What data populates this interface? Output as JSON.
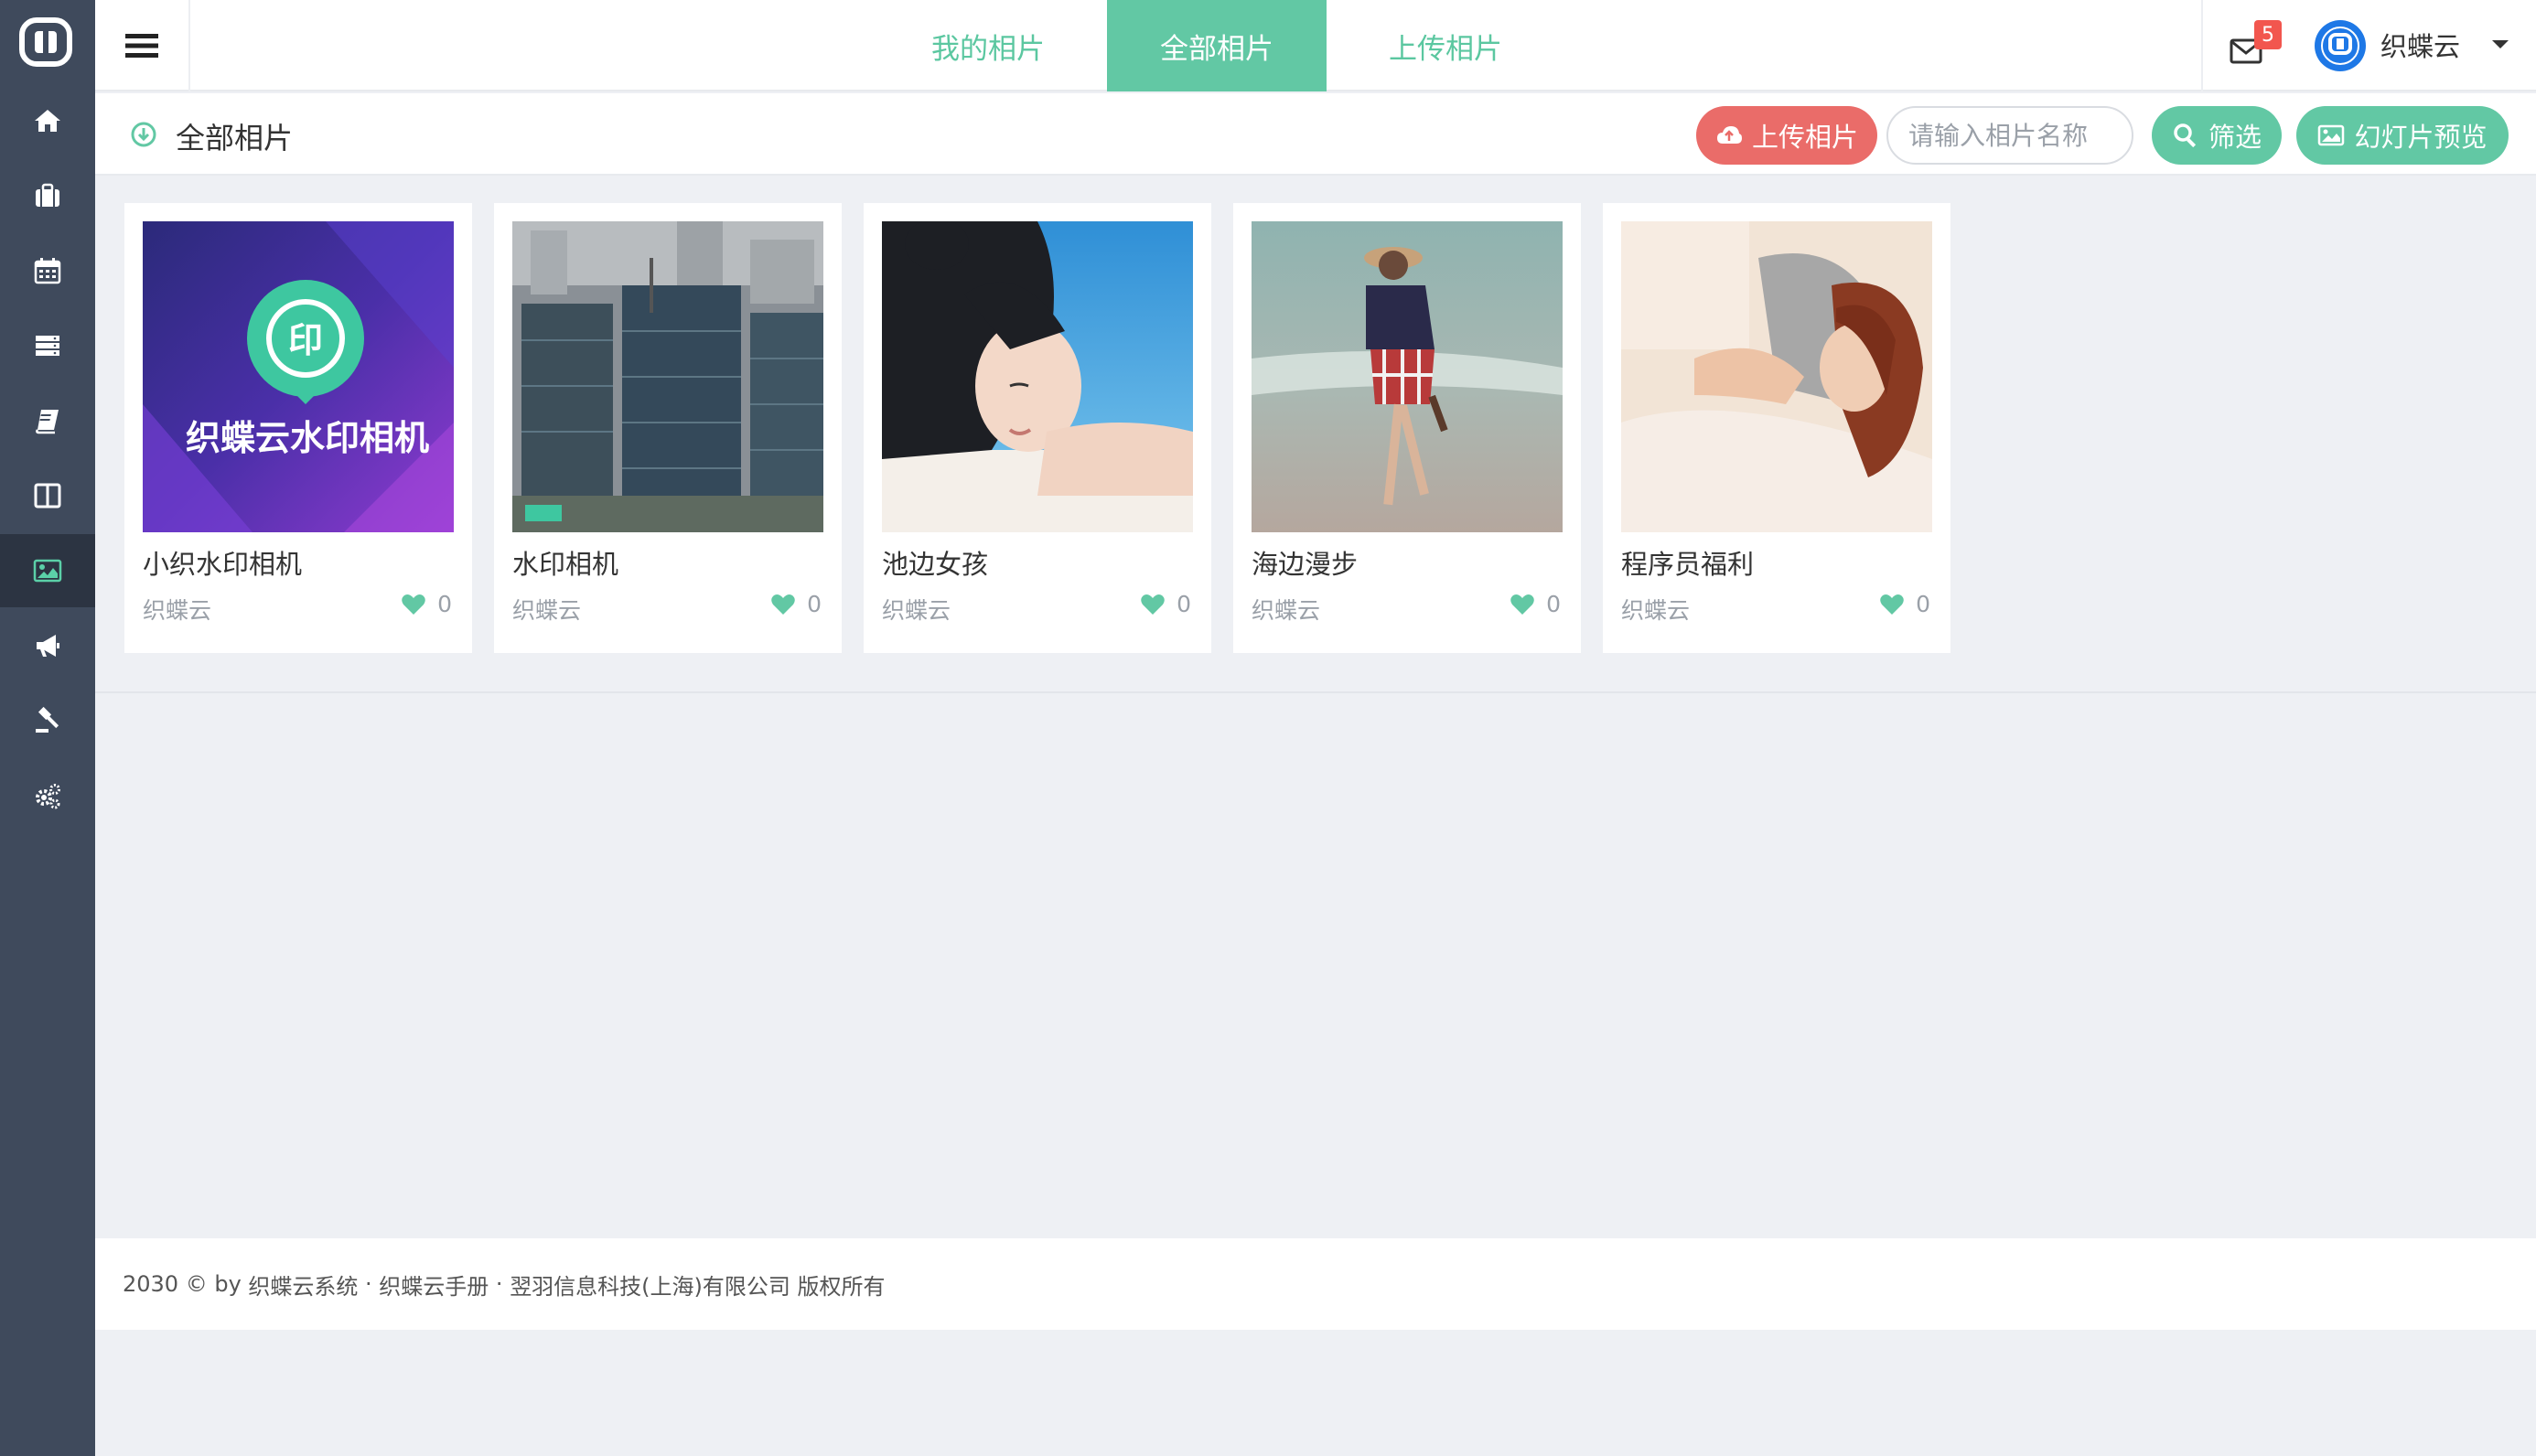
{
  "topbar": {
    "tabs": [
      {
        "label": "我的相片",
        "active": false
      },
      {
        "label": "全部相片",
        "active": true
      },
      {
        "label": "上传相片",
        "active": false
      }
    ],
    "mail_count": "5",
    "username": "织蝶云"
  },
  "sidebar": {
    "items": [
      {
        "icon": "home-icon"
      },
      {
        "icon": "briefcase-icon"
      },
      {
        "icon": "calendar-icon"
      },
      {
        "icon": "server-icon"
      },
      {
        "icon": "book-icon"
      },
      {
        "icon": "columns-icon"
      },
      {
        "icon": "image-icon",
        "active": true
      },
      {
        "icon": "bullhorn-icon"
      },
      {
        "icon": "gavel-icon"
      },
      {
        "icon": "gears-icon"
      }
    ]
  },
  "subheader": {
    "title": "全部相片",
    "upload_label": "上传相片",
    "search_placeholder": "请输入相片名称",
    "filter_label": "筛选",
    "slideshow_label": "幻灯片预览"
  },
  "photos": [
    {
      "title": "小织水印相机",
      "author": "织蝶云",
      "likes": "0",
      "overlay_text": "织蝶云水印相机",
      "logo_text": "印"
    },
    {
      "title": "水印相机",
      "author": "织蝶云",
      "likes": "0"
    },
    {
      "title": "池边女孩",
      "author": "织蝶云",
      "likes": "0"
    },
    {
      "title": "海边漫步",
      "author": "织蝶云",
      "likes": "0"
    },
    {
      "title": "程序员福利",
      "author": "织蝶云",
      "likes": "0"
    }
  ],
  "footer": {
    "year": "2030 © by ",
    "system_link": "织蝶云系统",
    "sep1": " · ",
    "manual_link": "织蝶云手册",
    "sep2": " · ",
    "company": "翌羽信息科技(上海)有限公司 版权所有"
  },
  "colors": {
    "sidebar_bg": "#3f4a5c",
    "accent_green": "#62c8a4",
    "upload_red": "#ea6c69",
    "badge_red": "#f2564e",
    "page_bg": "#eef0f4"
  }
}
